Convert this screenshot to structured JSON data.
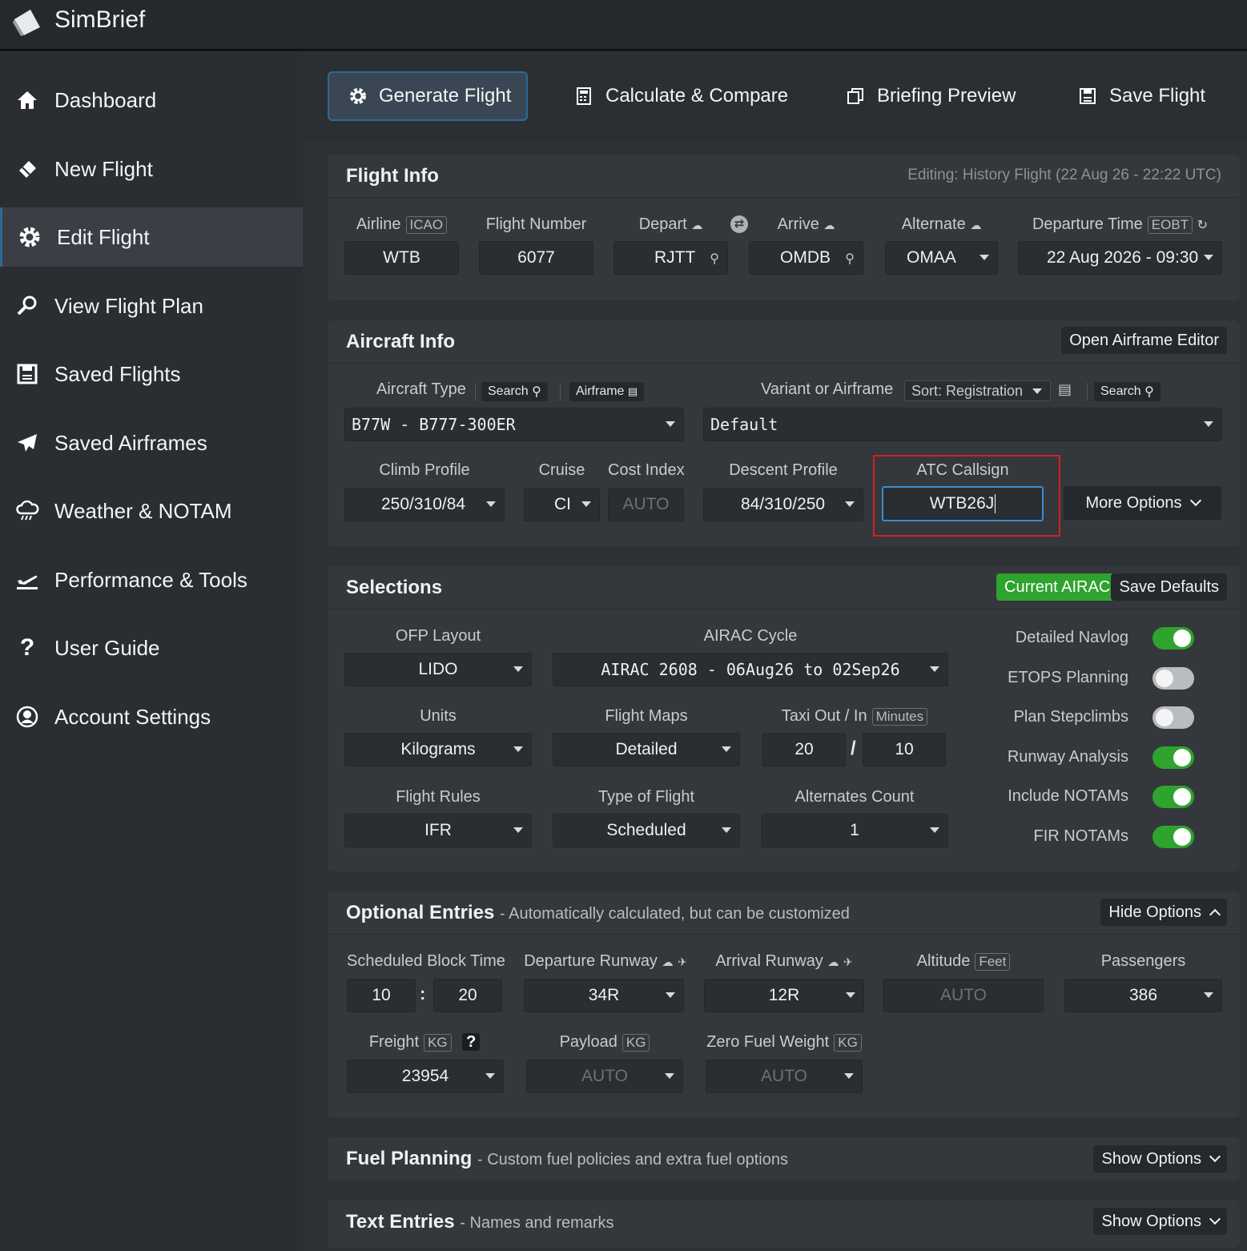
{
  "app": {
    "brand": "SimBrief"
  },
  "sidebar": {
    "items": [
      {
        "label": "Dashboard",
        "icon": "home-icon"
      },
      {
        "label": "New Flight",
        "icon": "eraser-icon"
      },
      {
        "label": "Edit Flight",
        "icon": "gear-icon",
        "active": true
      },
      {
        "label": "View Flight Plan",
        "icon": "magnifier-icon"
      },
      {
        "label": "Saved Flights",
        "icon": "save-icon"
      },
      {
        "label": "Saved Airframes",
        "icon": "paper-plane-icon"
      },
      {
        "label": "Weather & NOTAM",
        "icon": "cloud-icon"
      },
      {
        "label": "Performance & Tools",
        "icon": "takeoff-icon"
      },
      {
        "label": "User Guide",
        "icon": "question-icon"
      },
      {
        "label": "Account Settings",
        "icon": "user-circle-icon"
      }
    ]
  },
  "toolbar": {
    "generate": "Generate Flight",
    "calculate": "Calculate & Compare",
    "preview": "Briefing Preview",
    "save": "Save Flight"
  },
  "flight_info": {
    "title": "Flight Info",
    "editing": "Editing: History Flight (22 Aug 26 - 22:22 UTC)",
    "airline_label": "Airline",
    "airline_tag": "ICAO",
    "airline": "WTB",
    "flight_number_label": "Flight Number",
    "flight_number": "6077",
    "depart_label": "Depart",
    "depart": "RJTT",
    "arrive_label": "Arrive",
    "arrive": "OMDB",
    "alternate_label": "Alternate",
    "alternate": "OMAA",
    "departure_time_label": "Departure Time",
    "departure_time_tag": "EOBT",
    "departure_time": "22 Aug 2026 - 09:30"
  },
  "aircraft_info": {
    "title": "Aircraft Info",
    "editor_button": "Open Airframe Editor",
    "type_label": "Aircraft Type",
    "search": "Search",
    "airframe": "Airframe",
    "type": "B77W - B777-300ER",
    "variant_label": "Variant or Airframe",
    "sort": "Sort: Registration",
    "variant": "Default",
    "climb_label": "Climb Profile",
    "climb": "250/310/84",
    "cruise_label": "Cruise",
    "cruise": "CI",
    "cost_index_label": "Cost Index",
    "cost_index": "AUTO",
    "descent_label": "Descent Profile",
    "descent": "84/310/250",
    "callsign_label": "ATC Callsign",
    "callsign": "WTB26J",
    "more_options": "More Options"
  },
  "selections": {
    "title": "Selections",
    "current_airac": "Current AIRAC",
    "save_defaults": "Save Defaults",
    "ofp_label": "OFP Layout",
    "ofp": "LIDO",
    "airac_label": "AIRAC Cycle",
    "airac": "AIRAC 2608 - 06Aug26 to 02Sep26",
    "units_label": "Units",
    "units": "Kilograms",
    "maps_label": "Flight Maps",
    "maps": "Detailed",
    "taxi_label": "Taxi Out / In",
    "taxi_tag": "Minutes",
    "taxi_out": "20",
    "taxi_sep": "/",
    "taxi_in": "10",
    "rules_label": "Flight Rules",
    "rules": "IFR",
    "type_label": "Type of Flight",
    "type": "Scheduled",
    "alt_count_label": "Alternates Count",
    "alt_count": "1",
    "toggles": [
      {
        "label": "Detailed Navlog",
        "on": true
      },
      {
        "label": "ETOPS Planning",
        "on": false
      },
      {
        "label": "Plan Stepclimbs",
        "on": false
      },
      {
        "label": "Runway Analysis",
        "on": true
      },
      {
        "label": "Include NOTAMs",
        "on": true
      },
      {
        "label": "FIR NOTAMs",
        "on": true
      }
    ],
    "accent": "#2ea32e"
  },
  "optional": {
    "title": "Optional Entries",
    "subtitle": "- Automatically calculated, but can be customized",
    "hide": "Hide Options",
    "block_label": "Scheduled Block Time",
    "block_h": "10",
    "block_sep": ":",
    "block_m": "20",
    "dep_rwy_label": "Departure Runway",
    "dep_rwy": "34R",
    "arr_rwy_label": "Arrival Runway",
    "arr_rwy": "12R",
    "altitude_label": "Altitude",
    "altitude_tag": "Feet",
    "altitude": "AUTO",
    "pax_label": "Passengers",
    "pax": "386",
    "freight_label": "Freight",
    "freight_tag": "KG",
    "freight_help": "?",
    "freight": "23954",
    "payload_label": "Payload",
    "payload_tag": "KG",
    "payload": "AUTO",
    "zfw_label": "Zero Fuel Weight",
    "zfw_tag": "KG",
    "zfw": "AUTO"
  },
  "fuel": {
    "title": "Fuel Planning",
    "subtitle": "- Custom fuel policies and extra fuel options",
    "show": "Show Options"
  },
  "text_entries": {
    "title": "Text Entries",
    "subtitle": "- Names and remarks",
    "show": "Show Options"
  },
  "highlight_color": "#d42020"
}
